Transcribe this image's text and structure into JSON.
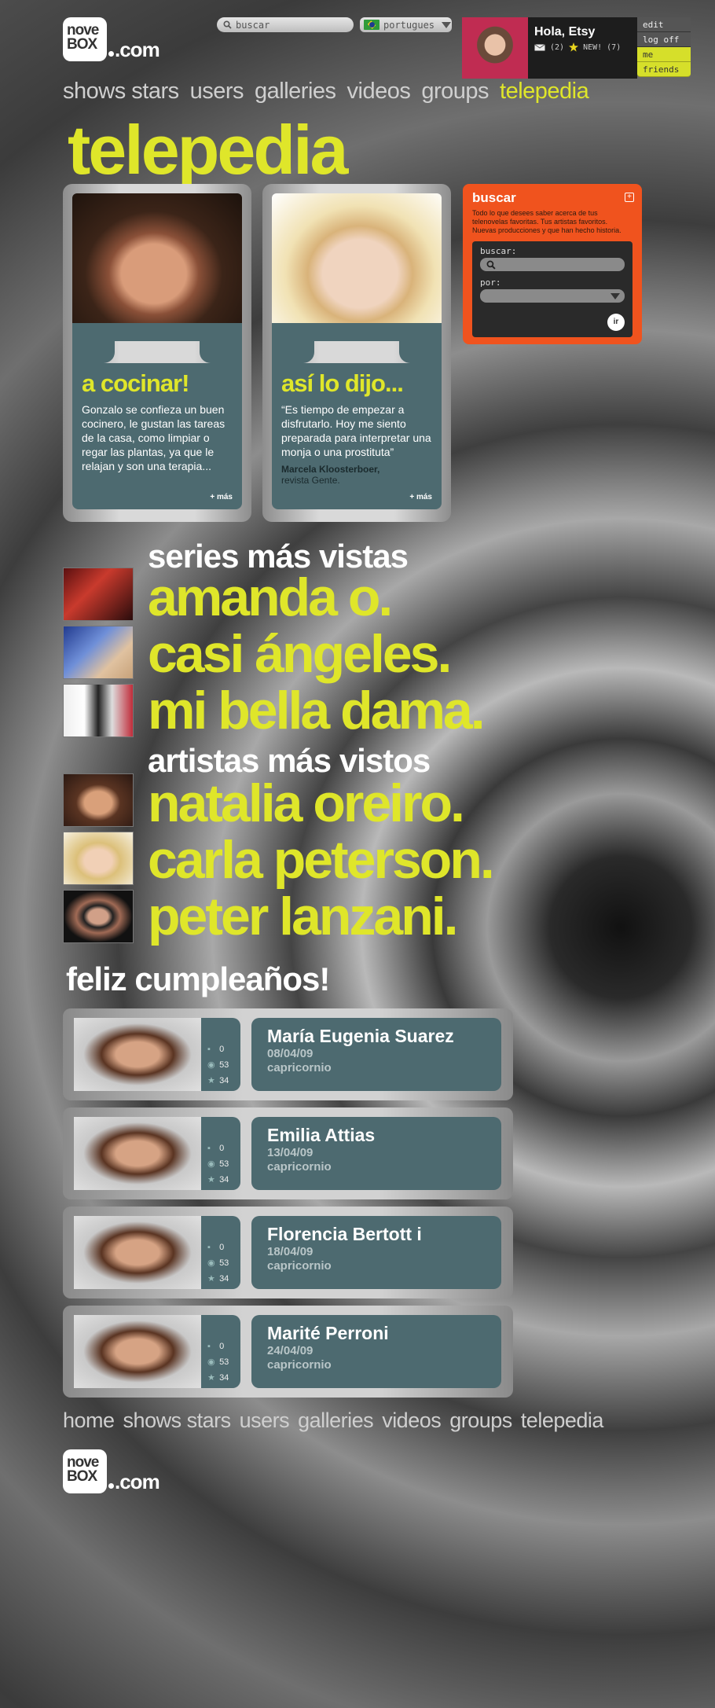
{
  "header": {
    "logo_top": "nove",
    "logo_bottom": "BOX",
    "logo_suffix": ".com",
    "search_placeholder": "buscar",
    "language": "portugues",
    "user": {
      "greeting": "Hola, Etsy",
      "messages": "(2)",
      "new_label": "NEW! (7)"
    },
    "user_menu": [
      "edit",
      "log off",
      "me",
      "friends"
    ]
  },
  "nav": {
    "items": [
      "shows stars",
      "users",
      "galleries",
      "videos",
      "groups",
      "telepedia"
    ],
    "active": "telepedia"
  },
  "page_title": "telepedia",
  "cards": [
    {
      "title": "a cocinar!",
      "text": "Gonzalo se confieza un buen cocinero, le gustan las tareas de la casa, como limpiar o regar las plantas, ya que le relajan y son una terapia...",
      "more": "+ más"
    },
    {
      "title": "así lo dijo...",
      "text": "“Es tiempo de empezar a disfrutarlo. Hoy me siento preparada para interpretar una monja o una prostituta”",
      "author": "Marcela Kloosterboer,",
      "source": "revista Gente.",
      "more": "+ más"
    }
  ],
  "buscar": {
    "title": "buscar",
    "description": "Todo lo que desees saber acerca de tus telenovelas favoritas. Tus artistas favoritos. Nuevas producciones y que han hecho historia.",
    "buscar_label": "buscar:",
    "por_label": "por:",
    "go": "ir"
  },
  "series": {
    "heading": "series más vistas",
    "items": [
      "amanda o.",
      "casi ángeles.",
      "mi bella dama."
    ]
  },
  "artistas": {
    "heading": "artistas más vistos",
    "items": [
      "natalia oreiro.",
      "carla peterson.",
      "peter lanzani."
    ]
  },
  "birthdays": {
    "heading": "feliz cumpleaños!",
    "items": [
      {
        "name": "María Eugenia Suarez",
        "date": "08/04/09",
        "sign": "capricornio",
        "comments": "0",
        "views": "53",
        "stars": "34"
      },
      {
        "name": "Emilia Attias",
        "date": "13/04/09",
        "sign": "capricornio",
        "comments": "0",
        "views": "53",
        "stars": "34"
      },
      {
        "name": "Florencia Bertott i",
        "date": "18/04/09",
        "sign": "capricornio",
        "comments": "0",
        "views": "53",
        "stars": "34"
      },
      {
        "name": "Marité Perroni",
        "date": "24/04/09",
        "sign": "capricornio",
        "comments": "0",
        "views": "53",
        "stars": "34"
      }
    ]
  },
  "footer_nav": [
    "home",
    "shows stars",
    "users",
    "galleries",
    "videos",
    "groups",
    "telepedia"
  ],
  "colors": {
    "accent": "#dfe62a",
    "panel": "#4d6a70",
    "search_box": "#f0531e"
  }
}
